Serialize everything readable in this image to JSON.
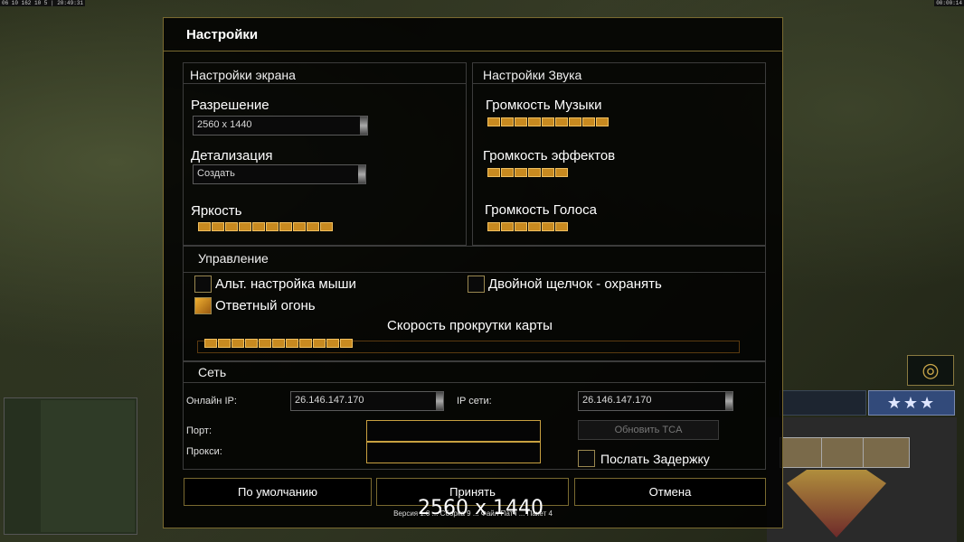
{
  "status": {
    "left": "06 10 162 10 5 | 20:49:31",
    "right": "00:00:14"
  },
  "dialog": {
    "title": "Настройки"
  },
  "screen": {
    "section": "Настройки экрана",
    "resolution_label": "Разрешение",
    "resolution_value": "2560 x 1440",
    "detail_label": "Детализация",
    "detail_value": "Создать",
    "brightness_label": "Яркость",
    "brightness_level": 10
  },
  "sound": {
    "section": "Настройки Звука",
    "music_label": "Громкость Музыки",
    "music_level": 9,
    "effects_label": "Громкость эффектов",
    "effects_level": 6,
    "voice_label": "Громкость Голоса",
    "voice_level": 6
  },
  "controls": {
    "section": "Управление",
    "alt_mouse_label": "Альт. настройка мыши",
    "alt_mouse_checked": false,
    "double_click_label": "Двойной щелчок - охранять",
    "double_click_checked": false,
    "retaliation_label": "Ответный огонь",
    "retaliation_checked": true,
    "scroll_label": "Скорость прокрутки карты",
    "scroll_level": 11
  },
  "network": {
    "section": "Сеть",
    "online_ip_label": "Онлайн IP:",
    "online_ip_value": "26.146.147.170",
    "lan_ip_label": "IP сети:",
    "lan_ip_value": "26.146.147.170",
    "port_label": "Порт:",
    "proxy_label": "Прокси:",
    "update_tca_label": "Обновить TCA",
    "send_delay_label": "Послать Задержку"
  },
  "buttons": {
    "default": "По умолчанию",
    "accept": "Принять",
    "cancel": "Отмена"
  },
  "version_text": "Версия 1.0 ... Сборка 9 ... Файл Патч ... Пакет 4",
  "overlay_text": "2560 x 1440",
  "colors": {
    "accent": "#c88a20",
    "border": "#7a6a30"
  }
}
